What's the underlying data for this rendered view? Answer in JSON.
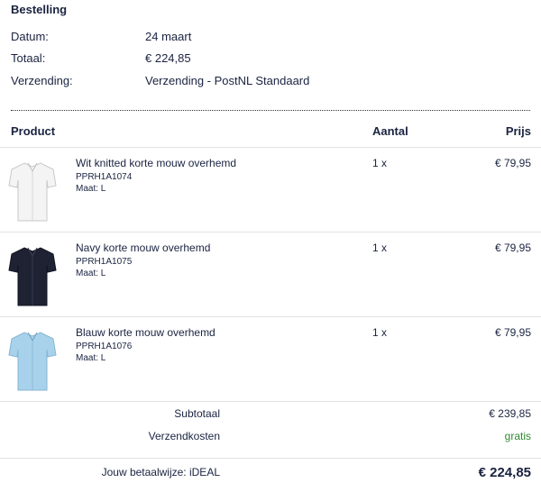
{
  "order": {
    "title": "Bestelling",
    "date_label": "Datum:",
    "date_value": "24 maart",
    "total_label": "Totaal:",
    "total_value": "€ 224,85",
    "shipping_label": "Verzending:",
    "shipping_value": "Verzending - PostNL Standaard"
  },
  "table": {
    "headers": {
      "product": "Product",
      "quantity": "Aantal",
      "price": "Prijs"
    },
    "items": [
      {
        "name": "Wit knitted korte mouw overhemd",
        "sku": "PPRH1A1074",
        "size": "Maat: L",
        "qty": "1 x",
        "price": "€ 79,95",
        "shirt_color": "#f4f4f4",
        "icon": "white-shirt"
      },
      {
        "name": "Navy korte mouw overhemd",
        "sku": "PPRH1A1075",
        "size": "Maat: L",
        "qty": "1 x",
        "price": "€ 79,95",
        "shirt_color": "#1e2233",
        "icon": "navy-shirt"
      },
      {
        "name": "Blauw korte mouw overhemd",
        "sku": "PPRH1A1076",
        "size": "Maat: L",
        "qty": "1 x",
        "price": "€ 79,95",
        "shirt_color": "#a8d2ec",
        "icon": "light-blue-shirt"
      }
    ]
  },
  "summary": {
    "subtotal_label": "Subtotaal",
    "subtotal_value": "€ 239,85",
    "shipping_cost_label": "Verzendkosten",
    "shipping_cost_value": "gratis",
    "payment_label": "Jouw betaalwijze: iDEAL",
    "grand_total": "€ 224,85"
  },
  "colors": {
    "text": "#1a2340",
    "free_green": "#2e8b2e",
    "divider": "#e2e2e2"
  }
}
